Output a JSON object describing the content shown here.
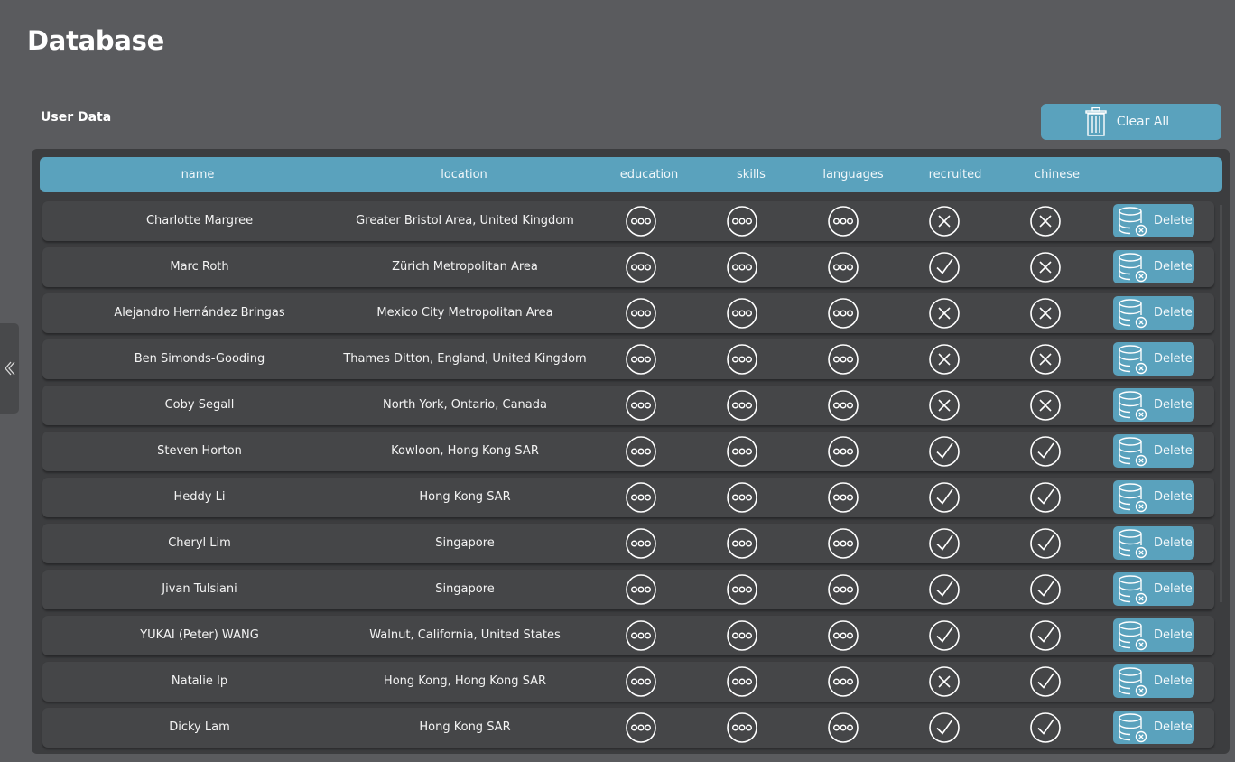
{
  "page": {
    "title": "Database"
  },
  "section": {
    "title": "User Data"
  },
  "toolbar": {
    "clear_all_label": "Clear All",
    "clear_all_icon": "trash-icon"
  },
  "sidebar_toggle": {
    "icon": "chevron-double-left-icon"
  },
  "colors": {
    "accent": "#5aa2bd",
    "background": "#5a5b5e",
    "panel": "#3c3d3f",
    "row": "#454648"
  },
  "table": {
    "columns": [
      "name",
      "location",
      "education",
      "skills",
      "languages",
      "recruited",
      "chinese"
    ],
    "delete_label": "Delete",
    "rows": [
      {
        "name": "Charlotte Margree",
        "location": "Greater Bristol Area, United Kingdom",
        "recruited": false,
        "chinese": false
      },
      {
        "name": "Marc Roth",
        "location": "Zürich Metropolitan Area",
        "recruited": true,
        "chinese": false
      },
      {
        "name": "Alejandro Hernández Bringas",
        "location": "Mexico City Metropolitan Area",
        "recruited": false,
        "chinese": false
      },
      {
        "name": "Ben Simonds-Gooding",
        "location": "Thames Ditton, England, United Kingdom",
        "recruited": false,
        "chinese": false
      },
      {
        "name": "Coby Segall",
        "location": "North York, Ontario, Canada",
        "recruited": false,
        "chinese": false
      },
      {
        "name": "Steven Horton",
        "location": "Kowloon, Hong Kong SAR",
        "recruited": true,
        "chinese": true
      },
      {
        "name": "Heddy Li",
        "location": "Hong Kong SAR",
        "recruited": true,
        "chinese": true
      },
      {
        "name": "Cheryl Lim",
        "location": "Singapore",
        "recruited": true,
        "chinese": true
      },
      {
        "name": "Jivan Tulsiani",
        "location": "Singapore",
        "recruited": true,
        "chinese": true
      },
      {
        "name": "YUKAI (Peter) WANG",
        "location": "Walnut, California, United States",
        "recruited": true,
        "chinese": true
      },
      {
        "name": "Natalie Ip",
        "location": "Hong Kong, Hong Kong SAR",
        "recruited": false,
        "chinese": true
      },
      {
        "name": "Dicky Lam",
        "location": "Hong Kong SAR",
        "recruited": true,
        "chinese": true
      }
    ]
  }
}
